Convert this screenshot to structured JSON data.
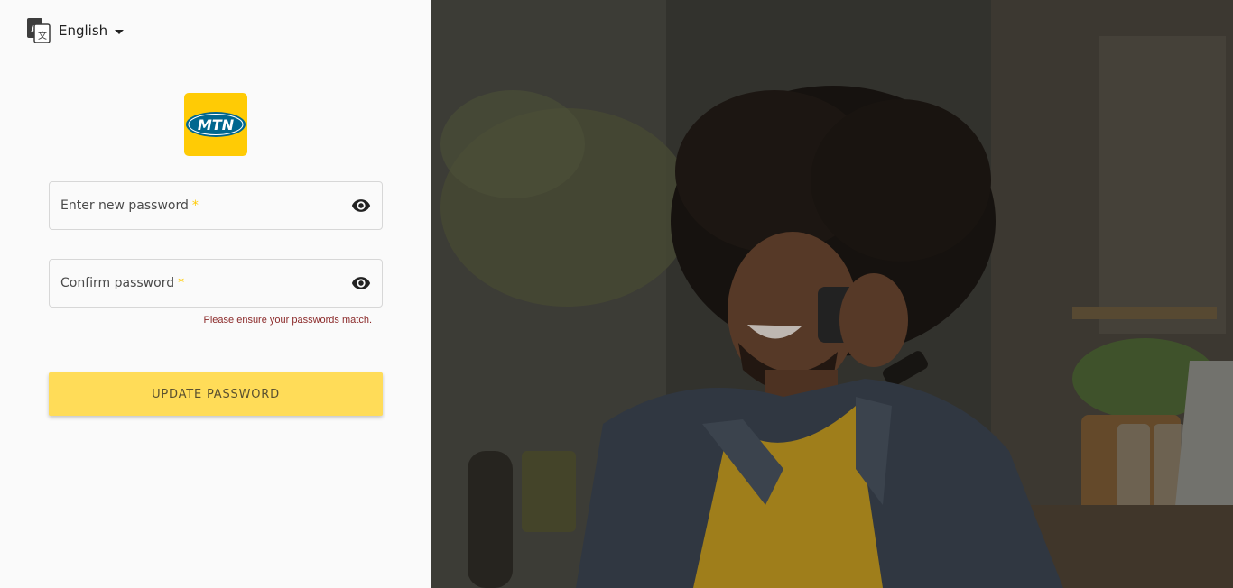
{
  "language": {
    "selected": "English",
    "icon": "translate-icon"
  },
  "brand": {
    "logo_text": "MTN",
    "color": "#ffcb05",
    "oval_color": "#00678f"
  },
  "form": {
    "new_password": {
      "label": "Enter new password",
      "required_mark": "*",
      "toggle_icon": "eye-icon"
    },
    "confirm_password": {
      "label": "Confirm password",
      "required_mark": "*",
      "toggle_icon": "eye-icon"
    },
    "error_message": "Please ensure your passwords match.",
    "submit_label": "UPDATE PASSWORD"
  },
  "hero": {
    "alt": "man-on-phone-photo"
  }
}
